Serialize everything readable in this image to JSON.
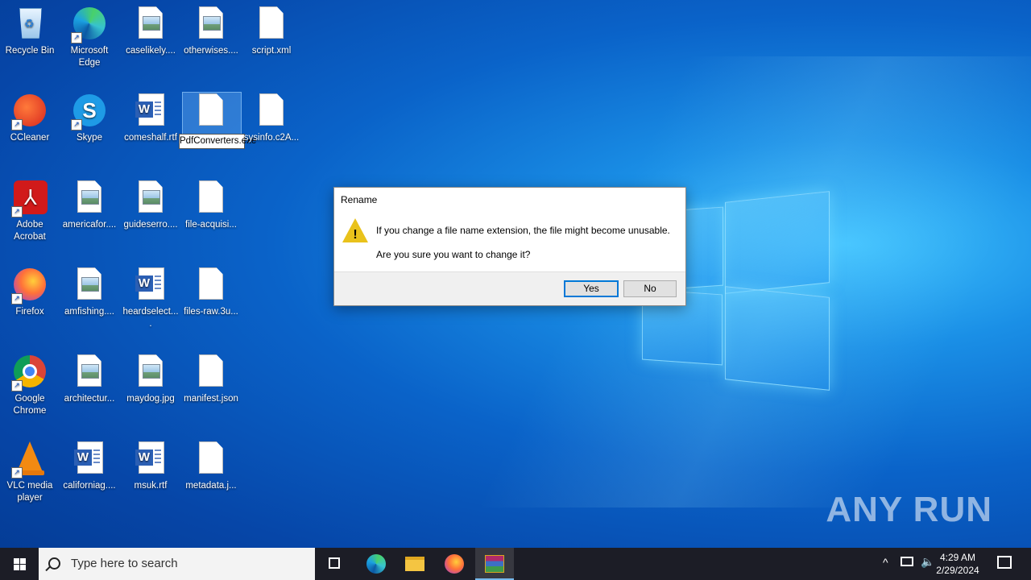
{
  "desktop": {
    "icons": [
      {
        "label": "Recycle Bin"
      },
      {
        "label": "Microsoft Edge"
      },
      {
        "label": "caselikely...."
      },
      {
        "label": "otherwises...."
      },
      {
        "label": "script.xml"
      },
      {
        "label": "CCleaner"
      },
      {
        "label": "Skype"
      },
      {
        "label": "comeshalf.rtf"
      },
      {
        "label": "sysinfo.c2A..."
      },
      {
        "label": "Adobe Acrobat"
      },
      {
        "label": "americafor...."
      },
      {
        "label": "guideserro...."
      },
      {
        "label": "file-acquisi..."
      },
      {
        "label": "Firefox"
      },
      {
        "label": "amfishing...."
      },
      {
        "label": "heardselect...."
      },
      {
        "label": "files-raw.3u..."
      },
      {
        "label": "Google Chrome"
      },
      {
        "label": "architectur..."
      },
      {
        "label": "maydog.jpg"
      },
      {
        "label": "manifest.json"
      },
      {
        "label": "VLC media player"
      },
      {
        "label": "californiag...."
      },
      {
        "label": "msuk.rtf"
      },
      {
        "label": "metadata.j..."
      }
    ],
    "rename_field_value": "PdfConverters.exe"
  },
  "dialog": {
    "title": "Rename",
    "message_line1": "If you change a file name extension, the file might become unusable.",
    "message_line2": "Are you sure you want to change it?",
    "yes_label": "Yes",
    "no_label": "No"
  },
  "watermark": "ANY RUN",
  "taskbar": {
    "search_placeholder": "Type here to search",
    "time": "4:29 AM",
    "date": "2/29/2024"
  },
  "colors": {
    "accent": "#0078d7",
    "taskbar_bg": "#1c1d26",
    "warning": "#e9c21b"
  }
}
